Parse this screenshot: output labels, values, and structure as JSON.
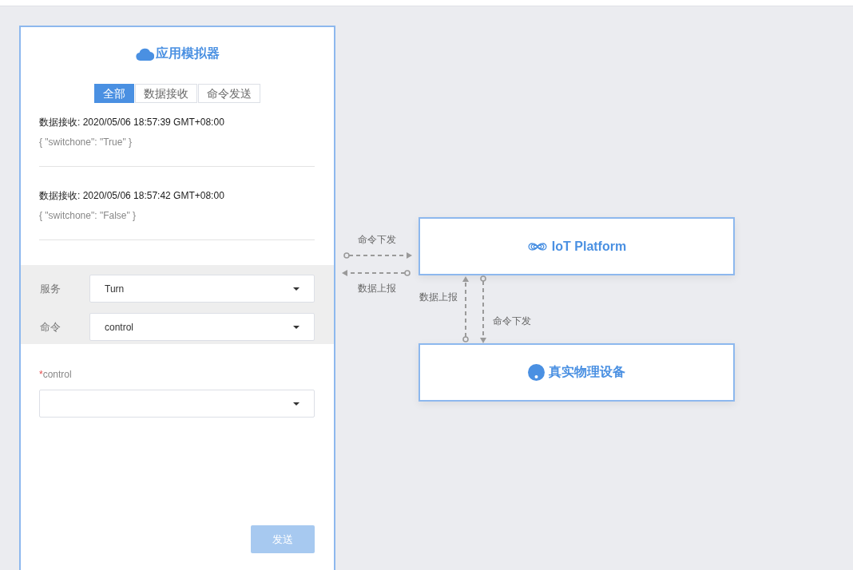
{
  "simulator": {
    "title": "应用模拟器",
    "tabs": [
      {
        "label": "全部",
        "selected": true
      },
      {
        "label": "数据接收",
        "selected": false
      },
      {
        "label": "命令发送",
        "selected": false
      }
    ],
    "messages": [
      {
        "heading": "数据接收: 2020/05/06 18:57:39 GMT+08:00",
        "body": "{ \"switchone\": \"True\" }"
      },
      {
        "heading": "数据接收: 2020/05/06 18:57:42 GMT+08:00",
        "body": "{ \"switchone\": \"False\" }"
      }
    ],
    "command_form": {
      "fields": [
        {
          "label": "服务",
          "value": "Turn"
        },
        {
          "label": "命令",
          "value": "control"
        }
      ]
    },
    "parameters": [
      {
        "required_mark": "*",
        "label": "control"
      }
    ],
    "send_button": {
      "label": "发送",
      "disabled": true
    }
  },
  "diagram": {
    "nodes": [
      {
        "kind": "platform",
        "label": "IoT Platform"
      },
      {
        "kind": "device",
        "label": "真实物理设备"
      }
    ],
    "links": [
      {
        "kind": "rightward",
        "label": "命令下发"
      },
      {
        "kind": "leftward",
        "label": "数据上报"
      },
      {
        "kind": "upward",
        "label": "数据上报"
      },
      {
        "kind": "downward",
        "label": "命令下发"
      }
    ]
  }
}
